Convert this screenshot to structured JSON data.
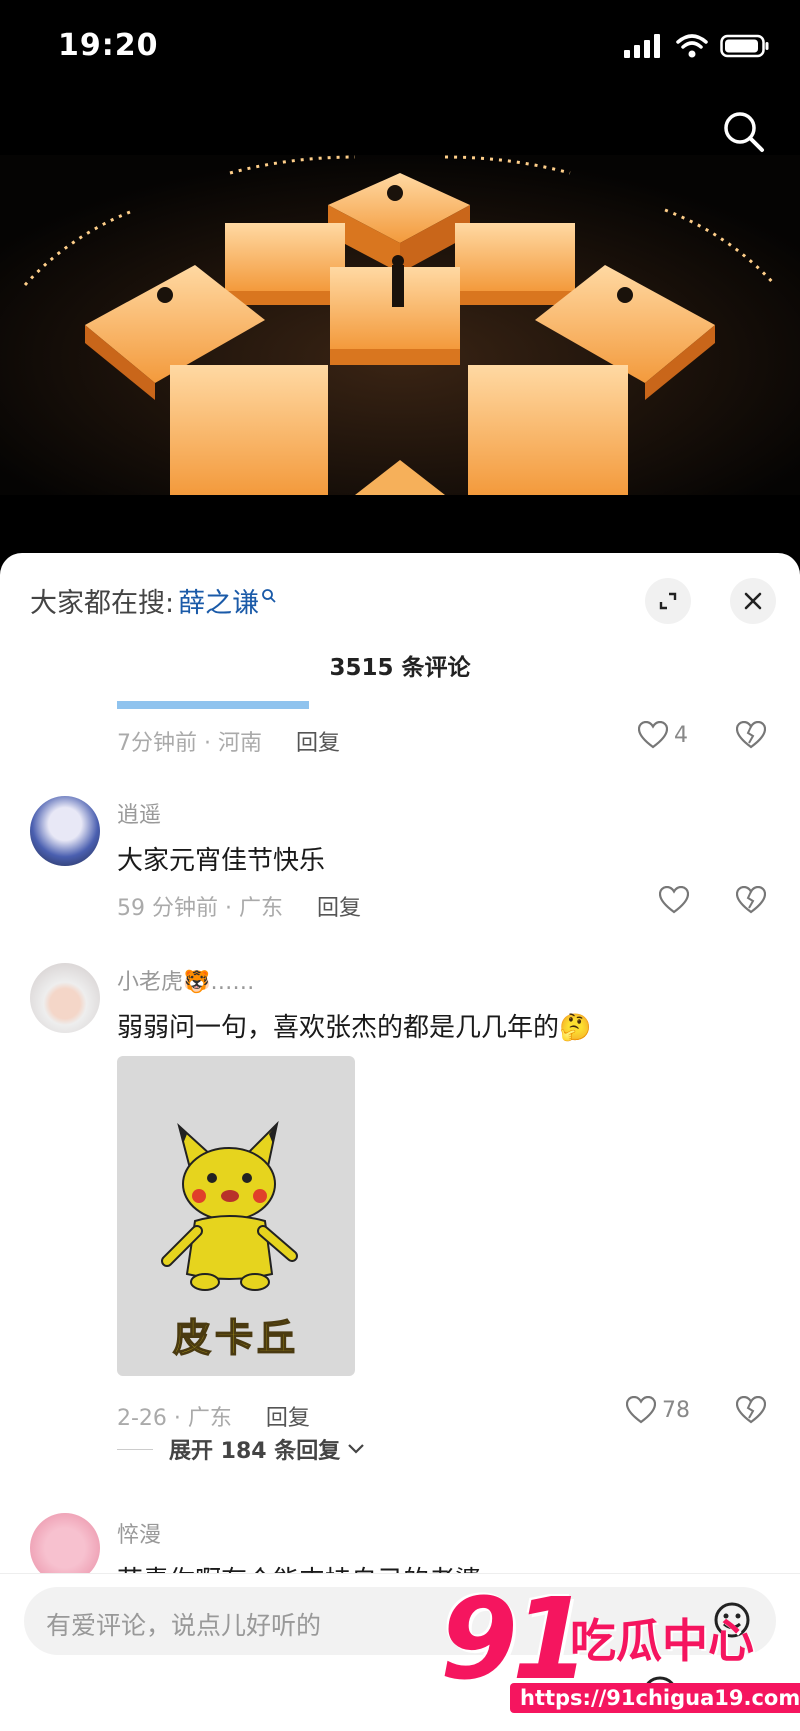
{
  "status": {
    "time": "19:20"
  },
  "sheet": {
    "hot_search_prefix": "大家都在搜:",
    "hot_search_keyword": "薛之谦",
    "comment_count": "3515 条评论"
  },
  "comments": [
    {
      "time_loc": "7分钟前 · 河南",
      "reply": "回复",
      "likes": "4"
    },
    {
      "user": "逍遥",
      "text": "大家元宵佳节快乐",
      "time_loc": "59 分钟前 · 广东",
      "reply": "回复",
      "likes": ""
    },
    {
      "user": "小老虎🐯……",
      "text": "弱弱问一句，喜欢张杰的都是几几年的🤔",
      "image_caption": "皮卡丘",
      "time_loc": "2-26 · 广东",
      "reply": "回复",
      "likes": "78",
      "expand": "展开 184 条回复"
    },
    {
      "user": "悴漫",
      "text": "花青你啊有个能支持自己的老婆"
    }
  ],
  "input": {
    "placeholder": "有爱评论，说点儿好听的"
  },
  "watermark": {
    "big": "91",
    "cn": "吃瓜中心",
    "url": "https://91chigua19.com"
  },
  "colors": {
    "accent_link": "#1a5aa8",
    "watermark": "#f5155f",
    "stage": "#f39a3c"
  }
}
